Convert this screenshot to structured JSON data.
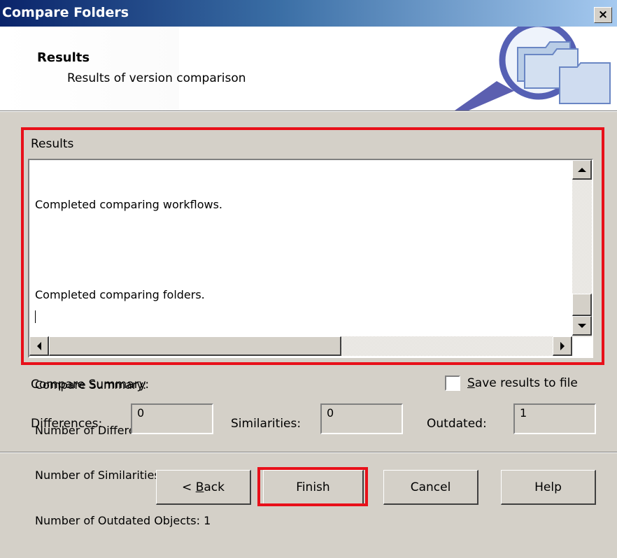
{
  "window": {
    "title": "Compare Folders",
    "close_glyph": "×"
  },
  "header": {
    "title": "Results",
    "subtitle": "Results of version comparison",
    "icon": "folder-magnifier-icon"
  },
  "results": {
    "label": "Results",
    "lines": [
      "Completed comparing workflows.",
      "",
      "Completed comparing folders.",
      "",
      "Compare Summary:",
      "Number of Differences: 0",
      "Number of Similarities: 0",
      "Number of Outdated Objects: 1"
    ]
  },
  "summary": {
    "label": "Compare Summary:",
    "save_to_file": {
      "label_prefix": "",
      "label_accel": "S",
      "label_rest": "ave results to file",
      "checked": false
    },
    "differences": {
      "label": "Differences:",
      "value": "0"
    },
    "similarities": {
      "label": "Similarities:",
      "value": "0"
    },
    "outdated": {
      "label": "Outdated:",
      "value": "1"
    }
  },
  "buttons": {
    "back": {
      "prefix": "< ",
      "accel": "B",
      "rest": "ack"
    },
    "finish": "Finish",
    "cancel": "Cancel",
    "help": "Help"
  },
  "colors": {
    "highlight": "#e8101a",
    "titlebar_start": "#0a246a",
    "dialog_bg": "#d4d0c8"
  }
}
